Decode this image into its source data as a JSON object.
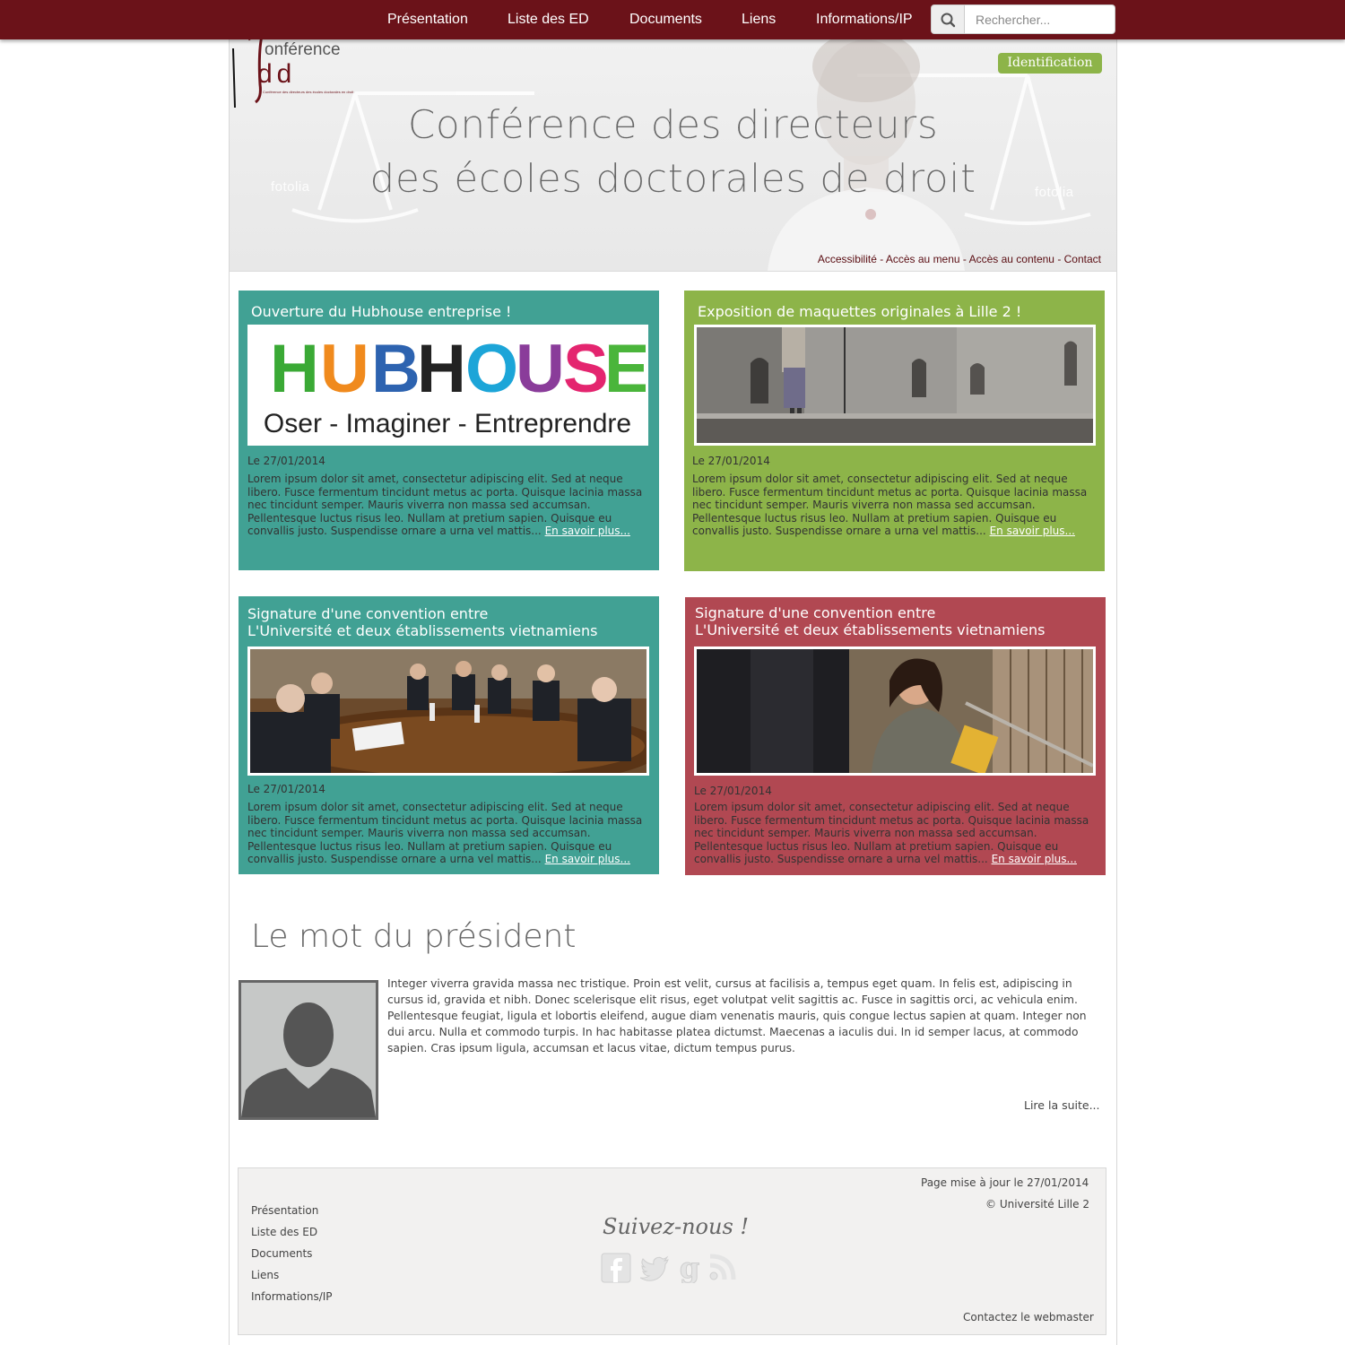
{
  "nav": {
    "items": [
      "Présentation",
      "Liste des ED",
      "Documents",
      "Liens",
      "Informations/IP"
    ],
    "search_placeholder": "Rechercher..."
  },
  "header": {
    "logo_conf": "onférence",
    "logo_dd": "dd",
    "logo_sub": "Conférence des directeurs des écoles doctorales en droit",
    "title_line1": "Conférence des directeurs",
    "title_line2": "des écoles doctorales de droit",
    "watermark": "fotolia",
    "identification": "Identification",
    "access_links": "Accessibilité - Accès au menu - Accès au contenu - Contact"
  },
  "cards": [
    {
      "title1": "Ouverture du Hubhouse  entreprise !",
      "title2": "",
      "image_word": "HUBHOUSE",
      "image_tagline": "Oser - Imaginer - Entreprendre",
      "date": "Le 27/01/2014",
      "text": "Lorem ipsum dolor sit amet, consectetur adipiscing elit. Sed at neque libero. Fusce fermentum tincidunt metus ac porta. Quisque lacinia massa nec tincidunt semper. Mauris viverra non massa sed accumsan. Pellentesque luctus risus leo. Nullam at pretium sapien. Quisque eu convallis justo. Suspendisse ornare a urna vel mattis...",
      "link": "En savoir plus...",
      "color": "#41a194"
    },
    {
      "title1": "Exposition de maquettes originales à Lille 2 !",
      "title2": "",
      "date": "Le 27/01/2014",
      "text": "Lorem ipsum dolor sit amet, consectetur adipiscing elit. Sed at neque libero. Fusce fermentum tincidunt metus ac porta. Quisque lacinia massa nec tincidunt semper. Mauris viverra non massa sed accumsan. Pellentesque luctus risus leo. Nullam at pretium sapien. Quisque eu convallis justo. Suspendisse ornare a urna vel mattis...",
      "link": "En savoir plus...",
      "color": "#8db449"
    },
    {
      "title1": "Signature d'une convention entre",
      "title2": "L'Université et deux établissements vietnamiens",
      "date": "Le 27/01/2014",
      "text": "Lorem ipsum dolor sit amet, consectetur adipiscing elit. Sed at neque libero. Fusce fermentum tincidunt metus ac porta. Quisque lacinia massa nec tincidunt semper. Mauris viverra non massa sed accumsan. Pellentesque luctus risus leo. Nullam at pretium sapien. Quisque eu convallis justo. Suspendisse ornare a urna vel mattis...",
      "link": "En savoir plus...",
      "color": "#41a194"
    },
    {
      "title1": "Signature d'une convention entre",
      "title2": "L'Université et deux établissements vietnamiens",
      "date": "Le 27/01/2014",
      "text": "Lorem ipsum dolor sit amet, consectetur adipiscing elit. Sed at neque libero. Fusce fermentum tincidunt metus ac porta. Quisque lacinia massa nec tincidunt semper. Mauris viverra non massa sed accumsan. Pellentesque luctus risus leo. Nullam at pretium sapien. Quisque eu convallis justo. Suspendisse ornare a urna vel mattis...",
      "link": "En savoir plus...",
      "color": "#b14852"
    }
  ],
  "president": {
    "title": "Le mot du président",
    "text": "Integer viverra gravida massa nec tristique. Proin est velit, cursus at facilisis a, tempus eget quam. In felis est, adipiscing in cursus id, gravida et nibh. Donec scelerisque elit risus, eget volutpat velit sagittis ac. Fusce in sagittis orci, ac vehicula enim. Pellentesque feugiat, ligula et lobortis eleifend, augue diam venenatis mauris, quis congue lectus sapien at quam. Integer non dui arcu. Nulla et commodo turpis. In hac habitasse platea dictumst. Maecenas a iaculis dui. In id semper lacus, at commodo sapien. Cras ipsum ligula, accumsan et lacus vitae, dictum tempus purus.",
    "more": "Lire la suite..."
  },
  "footer": {
    "links": [
      "Présentation",
      "Liste des ED",
      "Documents",
      "Liens",
      "Informations/IP"
    ],
    "updated": "Page mise à jour le 27/01/2014",
    "copyright": "© Université Lille 2",
    "follow": "Suivez-nous !",
    "contact": "Contactez le webmaster",
    "social_icons": [
      "facebook-icon",
      "twitter-icon",
      "google-plus-icon",
      "rss-icon"
    ]
  }
}
